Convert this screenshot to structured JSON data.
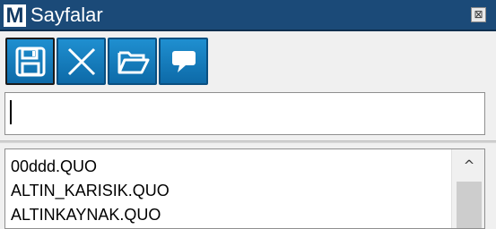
{
  "window": {
    "app_icon_letter": "M",
    "title": "Sayfalar",
    "close_glyph": "⊠"
  },
  "toolbar": {
    "buttons": [
      {
        "icon": "save-icon"
      },
      {
        "icon": "delete-icon"
      },
      {
        "icon": "folder-open-icon"
      },
      {
        "icon": "comment-icon"
      }
    ],
    "accent_color": "#1487c9"
  },
  "search": {
    "value": ""
  },
  "list": {
    "items": [
      "00ddd.QUO",
      "ALTIN_KARISIK.QUO",
      "ALTINKAYNAK.QUO"
    ],
    "scroll_up_glyph": "^"
  },
  "colors": {
    "titlebar": "#1b4a78",
    "button": "#1487c9"
  }
}
